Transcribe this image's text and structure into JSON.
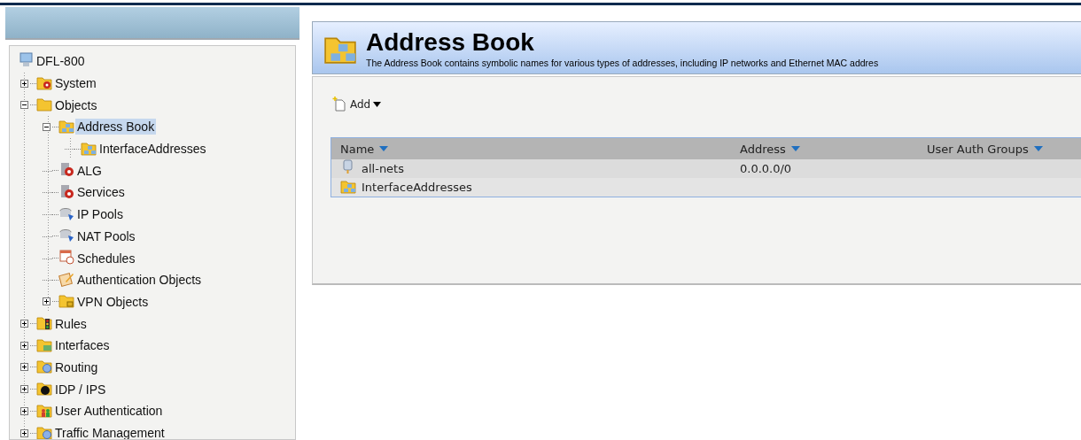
{
  "tree": {
    "root": {
      "label": "DFL-800",
      "kind": "device",
      "selected": false,
      "children": [
        {
          "label": "System",
          "kind": "folder-gear",
          "selected": false,
          "expanded": false
        },
        {
          "label": "Objects",
          "kind": "folder",
          "selected": false,
          "expanded": true,
          "children": [
            {
              "label": "Address Book",
              "kind": "address",
              "selected": true,
              "expanded": true,
              "children": [
                {
                  "label": "InterfaceAddresses",
                  "kind": "address",
                  "selected": false
                }
              ]
            },
            {
              "label": "ALG",
              "kind": "gear",
              "selected": false
            },
            {
              "label": "Services",
              "kind": "gear",
              "selected": false
            },
            {
              "label": "IP Pools",
              "kind": "pool",
              "selected": false
            },
            {
              "label": "NAT Pools",
              "kind": "pool",
              "selected": false
            },
            {
              "label": "Schedules",
              "kind": "calendar",
              "selected": false
            },
            {
              "label": "Authentication Objects",
              "kind": "pencil",
              "selected": false
            },
            {
              "label": "VPN Objects",
              "kind": "folder-lock",
              "selected": false,
              "expanded": false
            }
          ]
        },
        {
          "label": "Rules",
          "kind": "folder-lights",
          "selected": false,
          "expanded": false
        },
        {
          "label": "Interfaces",
          "kind": "folder-card",
          "selected": false,
          "expanded": false
        },
        {
          "label": "Routing",
          "kind": "folder-globe",
          "selected": false,
          "expanded": false
        },
        {
          "label": "IDP / IPS",
          "kind": "folder-bomb",
          "selected": false,
          "expanded": false
        },
        {
          "label": "User Authentication",
          "kind": "folder-users",
          "selected": false,
          "expanded": false
        },
        {
          "label": "Traffic Management",
          "kind": "folder-globe",
          "selected": false,
          "expanded": false
        }
      ]
    }
  },
  "header": {
    "title": "Address Book",
    "description": "The Address Book contains symbolic names for various types of addresses, including IP networks and Ethernet MAC addres"
  },
  "toolbar": {
    "add_button": "Add"
  },
  "table": {
    "columns": [
      "Name",
      "Address",
      "User Auth Groups"
    ],
    "rows": [
      {
        "kind": "network",
        "name": "all-nets",
        "address": "0.0.0.0/0"
      },
      {
        "kind": "address",
        "name": "InterfaceAddresses"
      }
    ]
  }
}
